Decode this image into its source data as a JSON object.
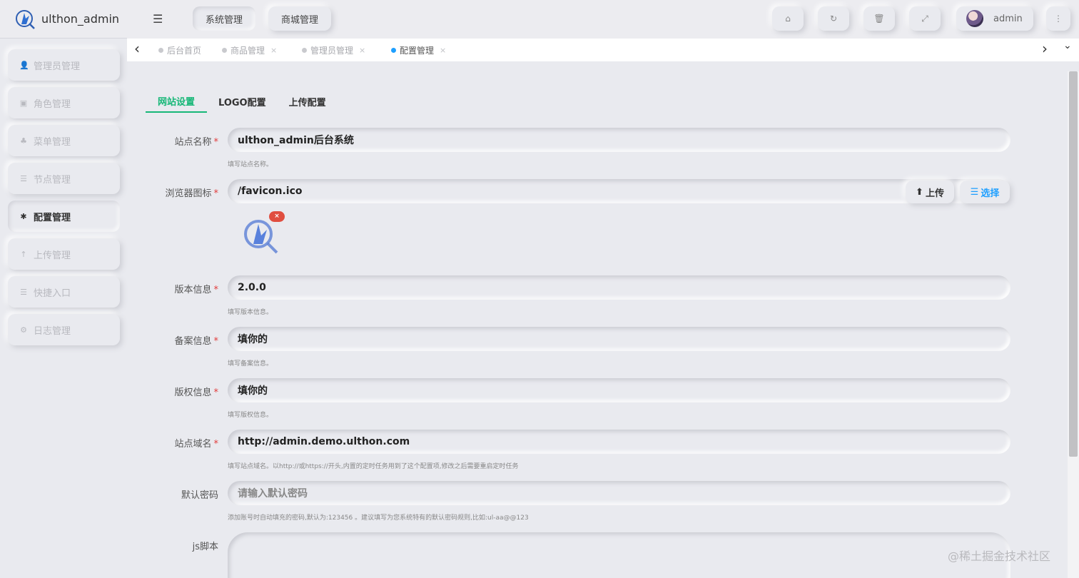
{
  "app": {
    "title": "ulthon_admin"
  },
  "sidebar": {
    "items": [
      {
        "label": "管理员管理",
        "icon": "user-icon",
        "glyph": "👤"
      },
      {
        "label": "角色管理",
        "icon": "role-icon",
        "glyph": "▣"
      },
      {
        "label": "菜单管理",
        "icon": "tree-icon",
        "glyph": "♣"
      },
      {
        "label": "节点管理",
        "icon": "list-icon",
        "glyph": "☰"
      },
      {
        "label": "配置管理",
        "icon": "asterisk-icon",
        "glyph": "✱"
      },
      {
        "label": "上传管理",
        "icon": "arrow-up-icon",
        "glyph": "↑"
      },
      {
        "label": "快捷入口",
        "icon": "list-icon",
        "glyph": "☰"
      },
      {
        "label": "日志管理",
        "icon": "gear-icon",
        "glyph": "⚙"
      }
    ],
    "active_index": 4
  },
  "header": {
    "toggle_glyph": "☰",
    "tabs": [
      {
        "label": "系统管理",
        "active": true
      },
      {
        "label": "商城管理",
        "active": false
      }
    ],
    "buttons": [
      {
        "name": "home-icon",
        "glyph": "⌂"
      },
      {
        "name": "refresh-icon",
        "glyph": "↻"
      },
      {
        "name": "trash-icon",
        "glyph": "🗑"
      },
      {
        "name": "fullscreen-icon",
        "glyph": "⤢"
      }
    ],
    "user": {
      "name": "admin"
    },
    "more_glyph": "⋮"
  },
  "tabstrip": {
    "left_arrow": "‹",
    "right_arrow": "›",
    "dropdown": "⌄",
    "tabs": [
      {
        "label": "后台首页",
        "closable": false,
        "active": false
      },
      {
        "label": "商品管理",
        "closable": true,
        "active": false
      },
      {
        "label": "管理员管理",
        "closable": true,
        "active": false
      },
      {
        "label": "配置管理",
        "closable": true,
        "active": true
      }
    ],
    "close_glyph": "×"
  },
  "form": {
    "tabs": [
      {
        "label": "网站设置",
        "active": true
      },
      {
        "label": "LOGO配置",
        "active": false
      },
      {
        "label": "上传配置",
        "active": false
      }
    ],
    "fields": {
      "site_name": {
        "label": "站点名称",
        "value": "ulthon_admin后台系统",
        "hint": "填写站点名称。"
      },
      "favicon": {
        "label": "浏览器图标",
        "value": "/favicon.ico",
        "upload_label": "上传",
        "select_label": "选择"
      },
      "version": {
        "label": "版本信息",
        "value": "2.0.0",
        "hint": "填写版本信息。"
      },
      "icp": {
        "label": "备案信息",
        "value": "填你的",
        "hint": "填写备案信息。"
      },
      "copyright": {
        "label": "版权信息",
        "value": "填你的",
        "hint": "填写版权信息。"
      },
      "domain": {
        "label": "站点域名",
        "value": "http://admin.demo.ulthon.com",
        "hint": "填写站点域名。以http://或https://开头,内置的定时任务用到了这个配置项,修改之后需要重启定时任务"
      },
      "default_password": {
        "label": "默认密码",
        "placeholder": "请输入默认密码",
        "hint": "添加账号时自动填充的密码,默认为:123456 。建议填写为您系统特有的默认密码规则,比如:ul-aa@@123"
      },
      "js_script": {
        "label": "js脚本"
      }
    },
    "required_mark": "*",
    "preview_close": "×"
  },
  "watermark": "@稀土掘金技术社区",
  "colors": {
    "accent": "#16b777",
    "primary": "#1e9fff",
    "danger": "#e04e40",
    "background": "#e9eaef"
  }
}
